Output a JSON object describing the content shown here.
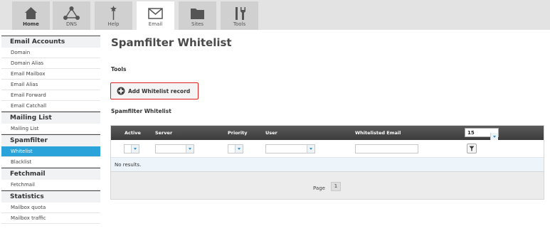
{
  "nav": {
    "tabs": [
      {
        "label": "Home",
        "icon": "home-icon"
      },
      {
        "label": "DNS",
        "icon": "dns-icon"
      },
      {
        "label": "Help",
        "icon": "help-icon"
      },
      {
        "label": "Email",
        "icon": "email-icon"
      },
      {
        "label": "Sites",
        "icon": "sites-icon"
      },
      {
        "label": "Tools",
        "icon": "tools-icon"
      }
    ],
    "active_tab": "Email"
  },
  "sidebar": {
    "sections": [
      {
        "title": "Email Accounts",
        "items": [
          "Domain",
          "Domain Alias",
          "Email Mailbox",
          "Email Alias",
          "Email Forward",
          "Email Catchall"
        ]
      },
      {
        "title": "Mailing List",
        "items": [
          "Mailing List"
        ]
      },
      {
        "title": "Spamfilter",
        "items": [
          "Whitelist",
          "Blacklist"
        ]
      },
      {
        "title": "Fetchmail",
        "items": [
          "Fetchmail"
        ]
      },
      {
        "title": "Statistics",
        "items": [
          "Mailbox quota",
          "Mailbox traffic"
        ]
      }
    ],
    "active_item": "Whitelist"
  },
  "main": {
    "title": "Spamfilter Whitelist",
    "tools_label": "Tools",
    "add_button": "Add Whitelist record",
    "list_label": "Spamfilter Whitelist"
  },
  "grid": {
    "columns": [
      "Active",
      "Server",
      "Priority",
      "User",
      "Whitelisted Email"
    ],
    "page_size": "15",
    "empty_text": "No results.",
    "pager_label": "Page",
    "current_page": "1"
  },
  "colors": {
    "accent": "#29a3d9",
    "header_dark": "#3b3b3b",
    "highlight_border": "#e02020"
  }
}
